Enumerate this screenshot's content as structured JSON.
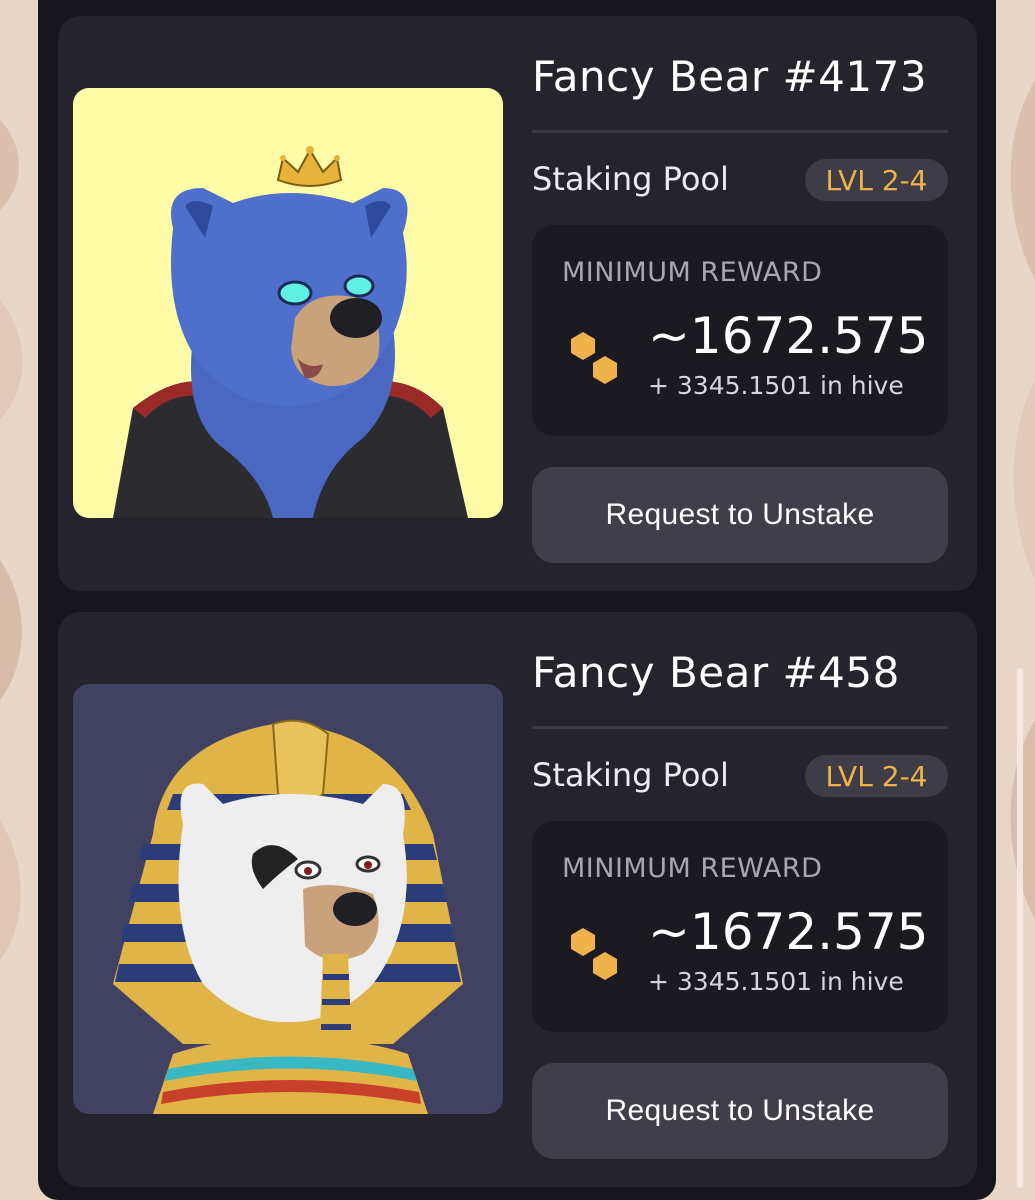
{
  "cards": [
    {
      "name": "Fancy Bear #4173",
      "pool_label": "Staking Pool",
      "level_badge": "LVL 2-4",
      "reward_title": "MINIMUM REWARD",
      "reward_amount": "~1672.575",
      "reward_secondary": "+ 3345.1501 in hive",
      "button_label": "Request to Unstake",
      "art_background": "#fffca8"
    },
    {
      "name": "Fancy Bear #458",
      "pool_label": "Staking Pool",
      "level_badge": "LVL 2-4",
      "reward_title": "MINIMUM REWARD",
      "reward_amount": "~1672.575",
      "reward_secondary": "+ 3345.1501 in hive",
      "button_label": "Request to Unstake",
      "art_background": "#414162"
    }
  ],
  "icons": {
    "reward_icon": "honey-hexagon-icon"
  },
  "colors": {
    "accent": "#f0b24a",
    "card_bg": "#25232c",
    "panel_bg": "#17161d"
  }
}
